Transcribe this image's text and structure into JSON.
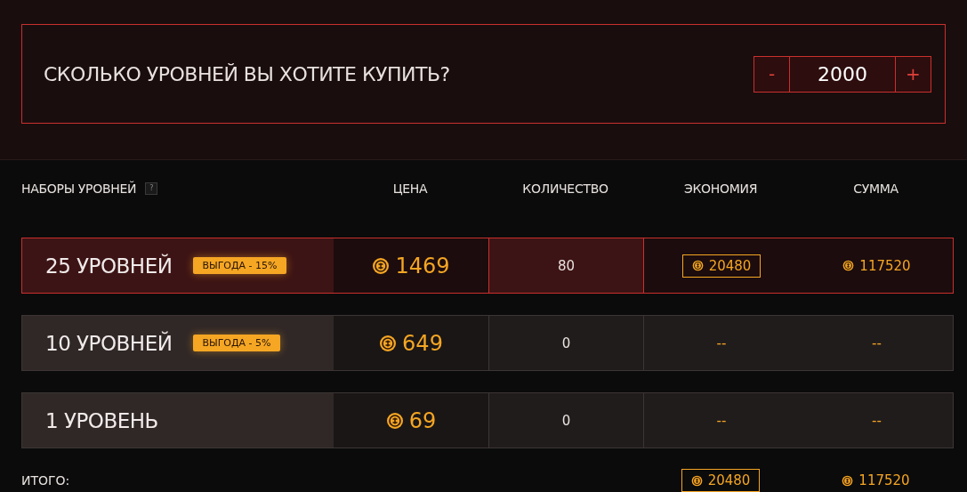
{
  "question": {
    "title": "СКОЛЬКО УРОВНЕЙ ВЫ ХОТИТЕ КУПИТЬ?",
    "minus": "-",
    "value": "2000",
    "plus": "+"
  },
  "table": {
    "columns": [
      {
        "label": "НАБОРЫ УРОВНЕЙ",
        "help": "?"
      },
      {
        "label": "ЦЕНА"
      },
      {
        "label": "КОЛИЧЕСТВО"
      },
      {
        "label": "ЭКОНОМИЯ"
      },
      {
        "label": "СУММА"
      }
    ],
    "rows": [
      {
        "name": "25 УРОВНЕЙ",
        "badge": "ВЫГОДА - 15%",
        "price": "1469",
        "quantity": "80",
        "savings": "20480",
        "sum": "117520",
        "selected": true
      },
      {
        "name": "10 УРОВНЕЙ",
        "badge": "ВЫГОДА - 5%",
        "price": "649",
        "quantity": "0",
        "savings": "--",
        "sum": "--",
        "selected": false
      },
      {
        "name": "1 УРОВЕНЬ",
        "price": "69",
        "quantity": "0",
        "savings": "--",
        "sum": "--",
        "selected": false
      }
    ]
  },
  "total": {
    "label": "ИТОГО:",
    "savings": "20480",
    "sum": "117520"
  }
}
